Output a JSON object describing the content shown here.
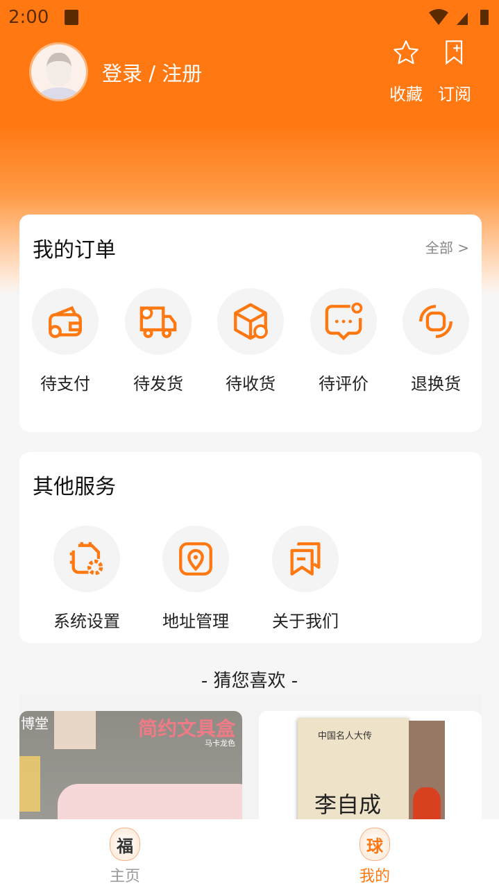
{
  "status_bar": {
    "time": "2:00"
  },
  "header": {
    "login_label": "登录 / 注册",
    "favorites_label": "收藏",
    "subscribe_label": "订阅"
  },
  "orders": {
    "title": "我的订单",
    "all_label": "全部 >",
    "items": [
      {
        "label": "待支付",
        "icon": "wallet-icon"
      },
      {
        "label": "待发货",
        "icon": "truck-icon"
      },
      {
        "label": "待收货",
        "icon": "package-icon"
      },
      {
        "label": "待评价",
        "icon": "comment-icon"
      },
      {
        "label": "退换货",
        "icon": "exchange-icon"
      }
    ]
  },
  "services": {
    "title": "其他服务",
    "items": [
      {
        "label": "系统设置",
        "icon": "settings-icon"
      },
      {
        "label": "地址管理",
        "icon": "location-icon"
      },
      {
        "label": "关于我们",
        "icon": "about-icon"
      }
    ]
  },
  "recommend": {
    "title": "- 猜您喜欢 -",
    "products": [
      {
        "image_text": "简约文具盒",
        "brand_text": "博堂",
        "sub_text": "马卡龙色"
      },
      {
        "image_text": "李自成",
        "series_text": "中国名人大传"
      }
    ]
  },
  "nav": {
    "items": [
      {
        "label": "主页",
        "glyph": "福",
        "active": false
      },
      {
        "label": "我的",
        "glyph": "球",
        "active": true
      }
    ]
  },
  "colors": {
    "accent": "#ff7812",
    "inactive": "#999999"
  }
}
